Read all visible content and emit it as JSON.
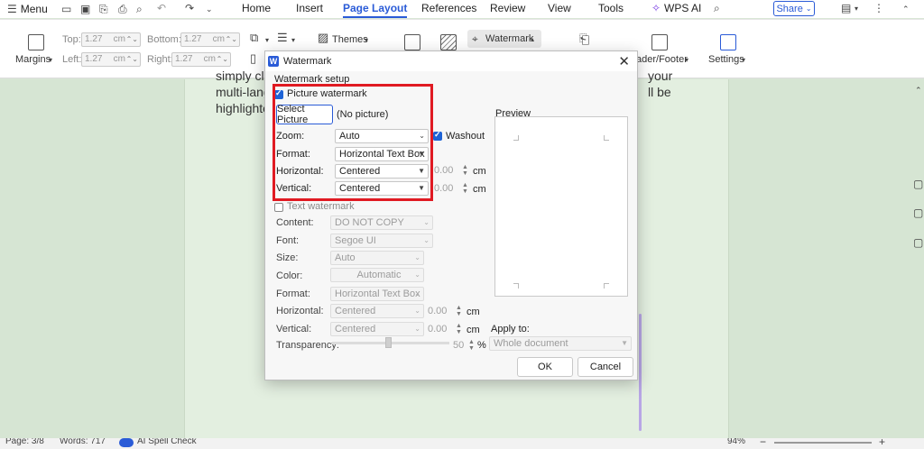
{
  "menubar": {
    "menu_label": "Menu",
    "tabs": [
      "Home",
      "Insert",
      "Page Layout",
      "References",
      "Review",
      "View",
      "Tools"
    ],
    "active_tab": "Page Layout",
    "wps_ai": "WPS AI",
    "share": "Share"
  },
  "ribbon": {
    "margins": "Margins",
    "top_label": "Top:",
    "top_value": "1.27",
    "bottom_label": "Bottom:",
    "bottom_value": "1.27",
    "left_label": "Left:",
    "left_value": "1.27",
    "right_label": "Right:",
    "right_value": "1.27",
    "unit": "cm",
    "themes": "Themes",
    "watermark": "Watermark",
    "header_footer": "ader/Footer",
    "settings": "Settings"
  },
  "document": {
    "line1_start": "simply cl",
    "line1_end": "your",
    "line2_start": "multi-lang",
    "line2_end": "ll be",
    "line3_start": "highlighte"
  },
  "dialog": {
    "title": "Watermark",
    "section": "Watermark setup",
    "picture_watermark": "Picture watermark",
    "select_picture": "Select Picture",
    "no_picture": "(No picture)",
    "zoom_label": "Zoom:",
    "zoom_value": "Auto",
    "washout": "Washout",
    "format_label": "Format:",
    "format_value": "Horizontal Text Box",
    "horizontal_label": "Horizontal:",
    "horizontal_value": "Centered",
    "horizontal_offset": "0.00",
    "vertical_label": "Vertical:",
    "vertical_value": "Centered",
    "vertical_offset": "0.00",
    "unit": "cm",
    "text_watermark": "Text watermark",
    "content_label": "Content:",
    "content_value": "DO NOT COPY",
    "font_label": "Font:",
    "font_value": "Segoe UI",
    "size_label": "Size:",
    "size_value": "Auto",
    "color_label": "Color:",
    "color_value": "Automatic",
    "t_format_label": "Format:",
    "t_format_value": "Horizontal Text Box",
    "t_horizontal_label": "Horizontal:",
    "t_horizontal_value": "Centered",
    "t_horizontal_offset": "0.00",
    "t_vertical_label": "Vertical:",
    "t_vertical_value": "Centered",
    "t_vertical_offset": "0.00",
    "transparency_label": "Transparency:",
    "transparency_value": "50",
    "transparency_unit": "%",
    "preview": "Preview",
    "apply_to_label": "Apply to:",
    "apply_to_value": "Whole document",
    "ok": "OK",
    "cancel": "Cancel"
  },
  "status": {
    "page": "Page: 3/8",
    "words": "Words: 717",
    "spell": "AI Spell Check",
    "zoom": "94%"
  }
}
